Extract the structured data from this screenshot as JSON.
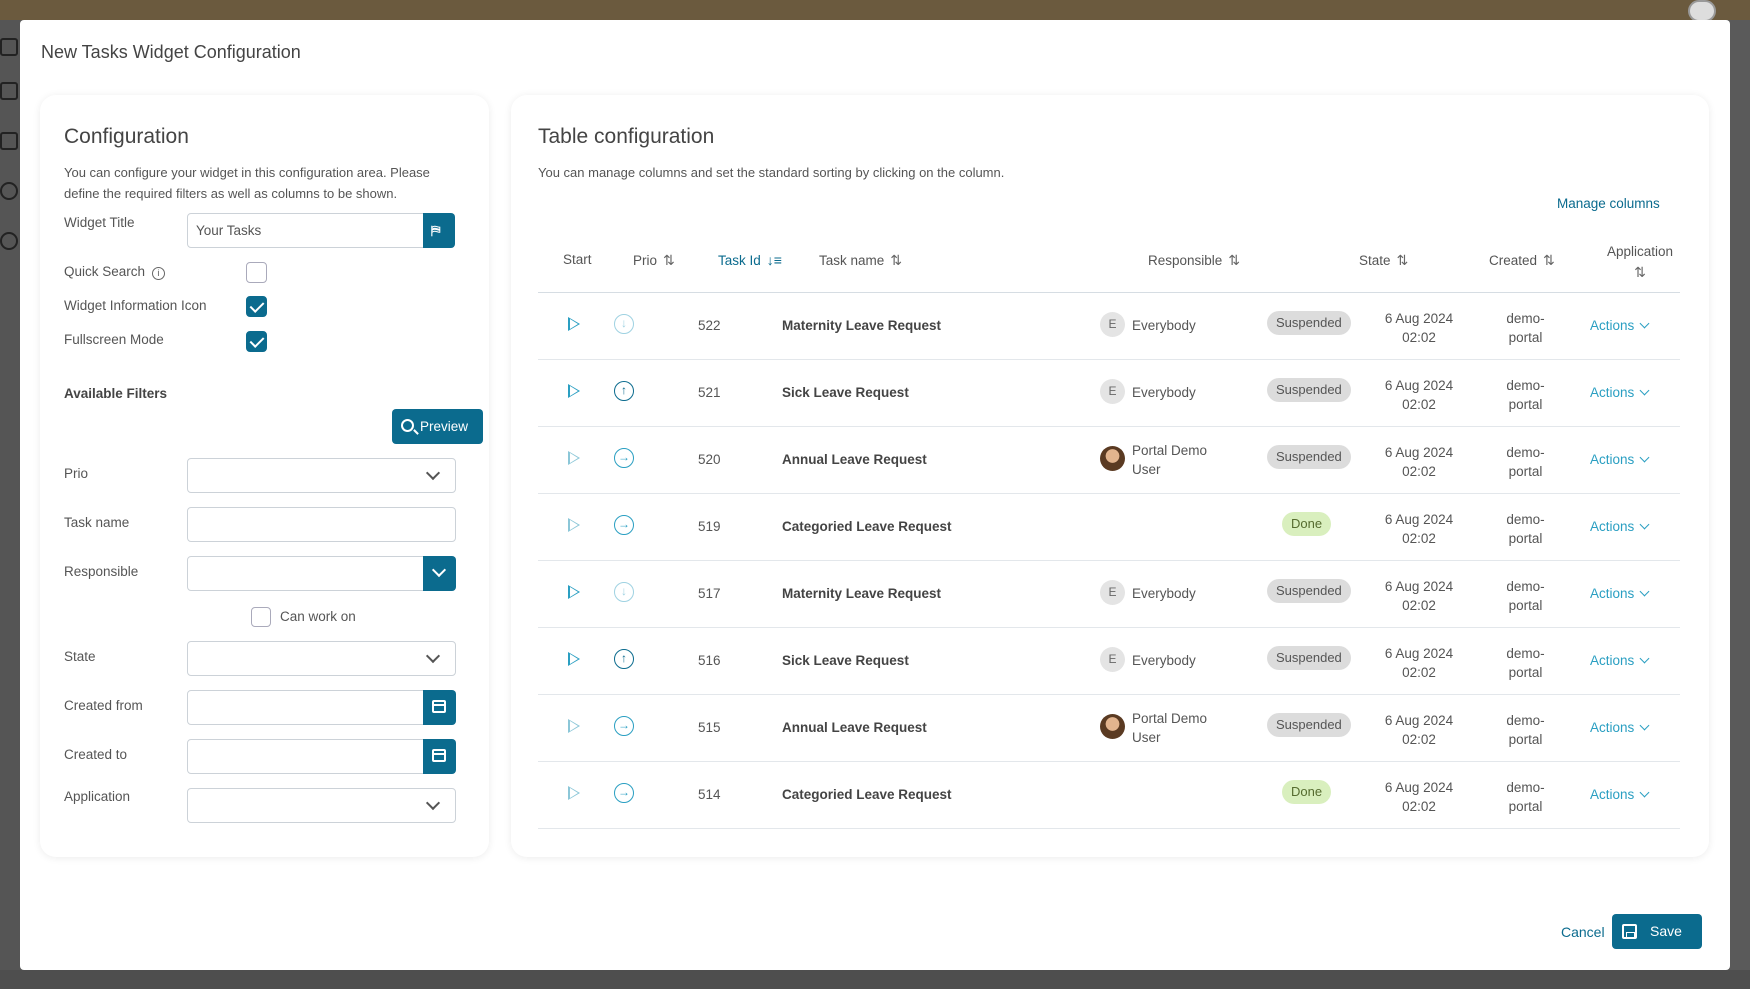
{
  "modal": {
    "title": "New Tasks Widget Configuration"
  },
  "config": {
    "heading": "Configuration",
    "description_line1": "You can configure your widget in this configuration area. Please",
    "description_line2": "define the required filters as well as columns to be shown.",
    "widget_title_label": "Widget Title",
    "widget_title_value": "Your Tasks",
    "quick_search_label": "Quick Search",
    "quick_search_checked": false,
    "widget_info_label": "Widget Information Icon",
    "widget_info_checked": true,
    "fullscreen_label": "Fullscreen Mode",
    "fullscreen_checked": true,
    "filters_heading": "Available Filters",
    "preview_label": "Preview",
    "filters": {
      "prio": "Prio",
      "task_name": "Task name",
      "responsible": "Responsible",
      "can_work_on": "Can work on",
      "state": "State",
      "created_from": "Created from",
      "created_to": "Created to",
      "application": "Application"
    }
  },
  "table": {
    "heading": "Table configuration",
    "description": "You can manage columns and set the standard sorting by clicking on the column.",
    "manage_columns": "Manage columns",
    "columns": {
      "start": "Start",
      "prio": "Prio",
      "task_id": "Task Id",
      "task_name": "Task name",
      "responsible": "Responsible",
      "state": "State",
      "created": "Created",
      "application": "Application"
    },
    "rows": [
      {
        "start_faint": false,
        "prio": "low",
        "prio_icon": "arrow-down-circle-icon",
        "id": "522",
        "name": "Maternity Leave Request",
        "resp_type": "everybody",
        "resp_initial": "E",
        "resp_line1": "Everybody",
        "resp_line2": "",
        "state": "Suspended",
        "state_type": "susp",
        "created_line1": "6 Aug 2024",
        "created_line2": "02:02",
        "app_line1": "demo-",
        "app_line2": "portal",
        "actions": "Actions"
      },
      {
        "start_faint": false,
        "prio": "high",
        "prio_icon": "arrow-up-circle-icon",
        "id": "521",
        "name": "Sick Leave Request",
        "resp_type": "everybody",
        "resp_initial": "E",
        "resp_line1": "Everybody",
        "resp_line2": "",
        "state": "Suspended",
        "state_type": "susp",
        "created_line1": "6 Aug 2024",
        "created_line2": "02:02",
        "app_line1": "demo-",
        "app_line2": "portal",
        "actions": "Actions"
      },
      {
        "start_faint": true,
        "prio": "normal",
        "prio_icon": "arrow-right-circle-icon",
        "id": "520",
        "name": "Annual Leave Request",
        "resp_type": "user",
        "resp_initial": "",
        "resp_line1": "Portal Demo",
        "resp_line2": "User",
        "state": "Suspended",
        "state_type": "susp",
        "created_line1": "6 Aug 2024",
        "created_line2": "02:02",
        "app_line1": "demo-",
        "app_line2": "portal",
        "actions": "Actions"
      },
      {
        "start_faint": true,
        "prio": "normal",
        "prio_icon": "arrow-right-circle-icon",
        "id": "519",
        "name": "Categoried Leave Request",
        "resp_type": "none",
        "resp_initial": "",
        "resp_line1": "",
        "resp_line2": "",
        "state": "Done",
        "state_type": "done",
        "created_line1": "6 Aug 2024",
        "created_line2": "02:02",
        "app_line1": "demo-",
        "app_line2": "portal",
        "actions": "Actions"
      },
      {
        "start_faint": false,
        "prio": "low",
        "prio_icon": "arrow-down-circle-icon",
        "id": "517",
        "name": "Maternity Leave Request",
        "resp_type": "everybody",
        "resp_initial": "E",
        "resp_line1": "Everybody",
        "resp_line2": "",
        "state": "Suspended",
        "state_type": "susp",
        "created_line1": "6 Aug 2024",
        "created_line2": "02:02",
        "app_line1": "demo-",
        "app_line2": "portal",
        "actions": "Actions"
      },
      {
        "start_faint": false,
        "prio": "high",
        "prio_icon": "arrow-up-circle-icon",
        "id": "516",
        "name": "Sick Leave Request",
        "resp_type": "everybody",
        "resp_initial": "E",
        "resp_line1": "Everybody",
        "resp_line2": "",
        "state": "Suspended",
        "state_type": "susp",
        "created_line1": "6 Aug 2024",
        "created_line2": "02:02",
        "app_line1": "demo-",
        "app_line2": "portal",
        "actions": "Actions"
      },
      {
        "start_faint": true,
        "prio": "normal",
        "prio_icon": "arrow-right-circle-icon",
        "id": "515",
        "name": "Annual Leave Request",
        "resp_type": "user",
        "resp_initial": "",
        "resp_line1": "Portal Demo",
        "resp_line2": "User",
        "state": "Suspended",
        "state_type": "susp",
        "created_line1": "6 Aug 2024",
        "created_line2": "02:02",
        "app_line1": "demo-",
        "app_line2": "portal",
        "actions": "Actions"
      },
      {
        "start_faint": true,
        "prio": "normal",
        "prio_icon": "arrow-right-circle-icon",
        "id": "514",
        "name": "Categoried Leave Request",
        "resp_type": "none",
        "resp_initial": "",
        "resp_line1": "",
        "resp_line2": "",
        "state": "Done",
        "state_type": "done",
        "created_line1": "6 Aug 2024",
        "created_line2": "02:02",
        "app_line1": "demo-",
        "app_line2": "portal",
        "actions": "Actions"
      }
    ]
  },
  "footer": {
    "cancel": "Cancel",
    "save": "Save"
  },
  "colors": {
    "primary": "#0b6b8e",
    "accent": "#2a9fc2",
    "suspended_bg": "#dcdcdc",
    "done_bg": "#d9efbe"
  }
}
